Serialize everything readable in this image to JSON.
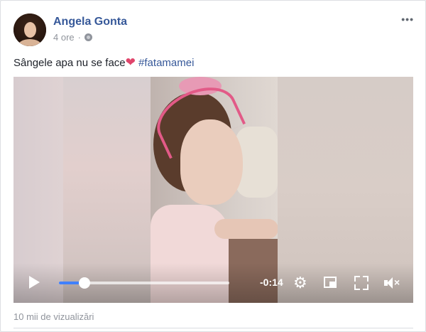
{
  "post": {
    "author": "Angela Gonta",
    "time": "4 ore",
    "separator": "·",
    "privacy_icon": "globe-icon",
    "more_icon": "ellipsis-icon",
    "more_label": "•••",
    "text": "Sângele apa nu se face",
    "emoji": "❤",
    "hashtag": "#fatamamei"
  },
  "video": {
    "play_icon": "play-icon",
    "progress": 0.15,
    "time_remaining": "-0:14",
    "settings_icon": "gear-icon",
    "gear_glyph": "⚙",
    "pip_icon": "picture-in-picture-icon",
    "fullscreen_icon": "fullscreen-icon",
    "mute_icon": "mute-icon",
    "mute_glyph": "×",
    "accent": "#4080ff"
  },
  "footer": {
    "views": "10 mii de vizualizări"
  },
  "colors": {
    "link": "#365899",
    "meta": "#90949c",
    "text": "#1d2129"
  }
}
